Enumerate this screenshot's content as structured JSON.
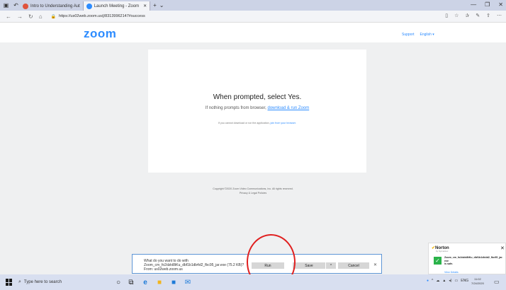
{
  "browser": {
    "tabs": [
      {
        "label": "Intro to Understanding Aut",
        "icon": "pdf-icon",
        "color": "#e0533d"
      },
      {
        "label": "Launch Meeting - Zoom",
        "icon": "zoom-icon",
        "color": "#2d8cff"
      }
    ],
    "url": "https://us02web.zoom.us/j/83139962147#success"
  },
  "page": {
    "logo": "zoom",
    "support": "Support",
    "language": "English ▾",
    "prompt": "When prompted, select Yes.",
    "sub_text": "If nothing prompts from browser,",
    "sub_link": "download & run Zoom",
    "small_text": "If you cannot download or run the application,",
    "small_link": "join from your browser.",
    "copyright": "Copyright ©2020 Zoom Video Communications, Inc. All rights reserved.",
    "privacy": "Privacy & Legal Policies"
  },
  "download_bar": {
    "question": "What do you want to do with",
    "filename": "Zoom_cm_fo2dzkt8tKu_dbf1b1db4d2_fbc95_jar.exe (75.2 KB)?",
    "from": "From: us02web.zoom.us",
    "run": "Run",
    "save": "Save",
    "cancel": "Cancel"
  },
  "norton": {
    "brand": "Norton",
    "sub": "by Symantec",
    "file": "Zoom_cm_fo2dzkt8tKu_dbf1b1db4d2_fbc95_jar.exe",
    "status": "is safe.",
    "link": "View Details"
  },
  "taskbar": {
    "search_placeholder": "Type here to search",
    "lang": "ENG",
    "time": "11:02",
    "date": "7/24/2020"
  },
  "colors": {
    "accent": "#2d8cff",
    "annotation": "#e02020",
    "safe": "#2bb34a"
  }
}
